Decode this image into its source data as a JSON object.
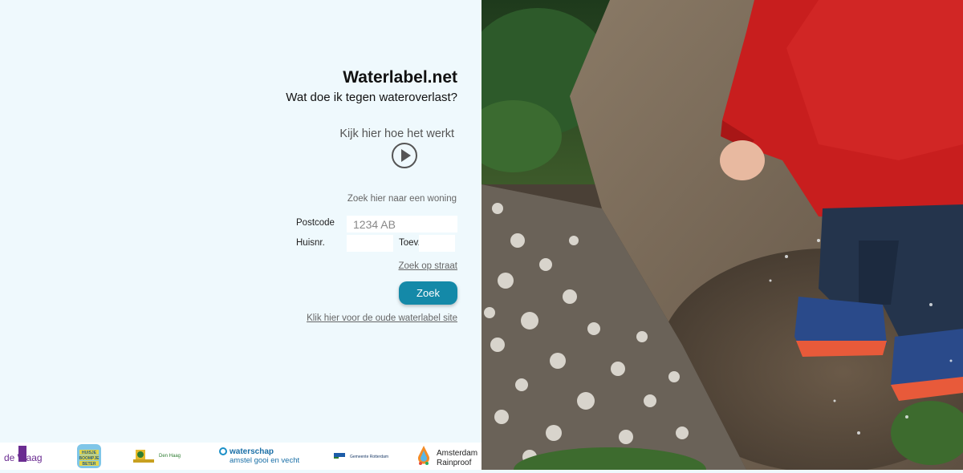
{
  "header": {
    "title": "Waterlabel.net",
    "subtitle": "Wat doe ik tegen wateroverlast?"
  },
  "video": {
    "label": "Kijk hier hoe het werkt",
    "icon": "play-circle-icon"
  },
  "search": {
    "heading": "Zoek hier naar een woning",
    "postcode_label": "Postcode",
    "postcode_placeholder": "1234 AB",
    "postcode_value": "",
    "huisnr_label": "Huisnr.",
    "huisnr_value": "",
    "toev_label": "Toev.",
    "toev_value": "",
    "street_link": "Zoek op straat",
    "submit_label": "Zoek",
    "old_site_link": "Klik hier voor de oude waterlabel site"
  },
  "logos": {
    "dewaag": "de Waag",
    "huisje": [
      "HUISJE",
      "BOOMPJE",
      "BETER"
    ],
    "denhaag": "Den Haag",
    "waterschap_line1": "waterschap",
    "waterschap_line2": "amstel gooi en vecht",
    "rotterdam": "Gemeente Rotterdam",
    "amsterdam_line1": "Amsterdam",
    "amsterdam_line2": "Rainproof"
  },
  "colors": {
    "accent": "#1489a8",
    "background": "#eff9fd"
  },
  "photo": {
    "description_icon": "child-in-puddle-photo"
  }
}
